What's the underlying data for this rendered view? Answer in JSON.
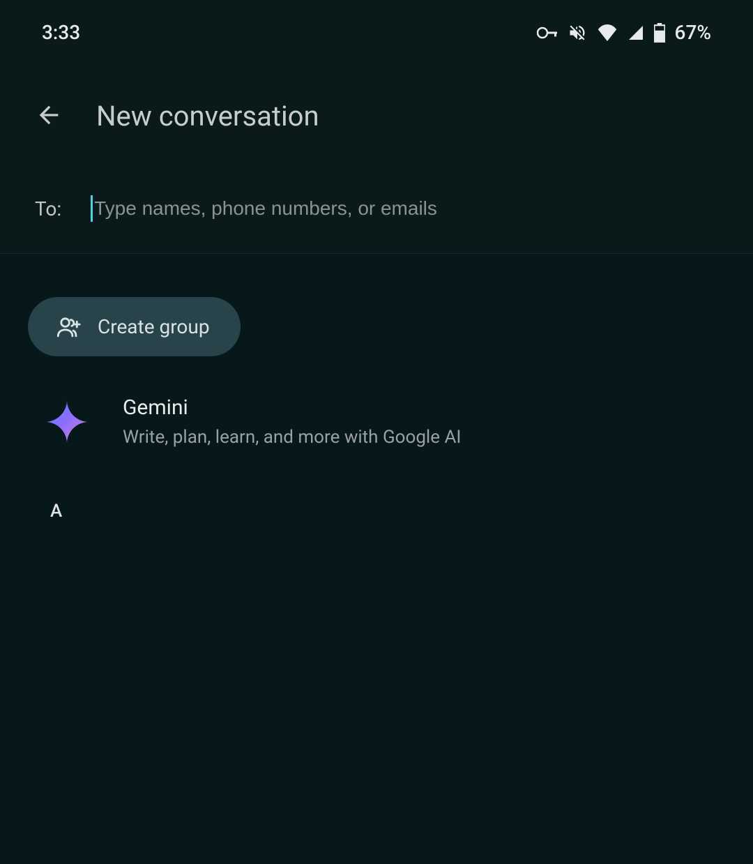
{
  "status": {
    "time": "3:33",
    "battery": "67%"
  },
  "header": {
    "title": "New conversation"
  },
  "recipient": {
    "label": "To:",
    "placeholder": "Type names, phone numbers, or emails"
  },
  "actions": {
    "create_group": "Create group"
  },
  "gemini": {
    "title": "Gemini",
    "subtitle": "Write, plan, learn, and more with Google AI"
  },
  "contacts": {
    "section_letter": "A"
  }
}
